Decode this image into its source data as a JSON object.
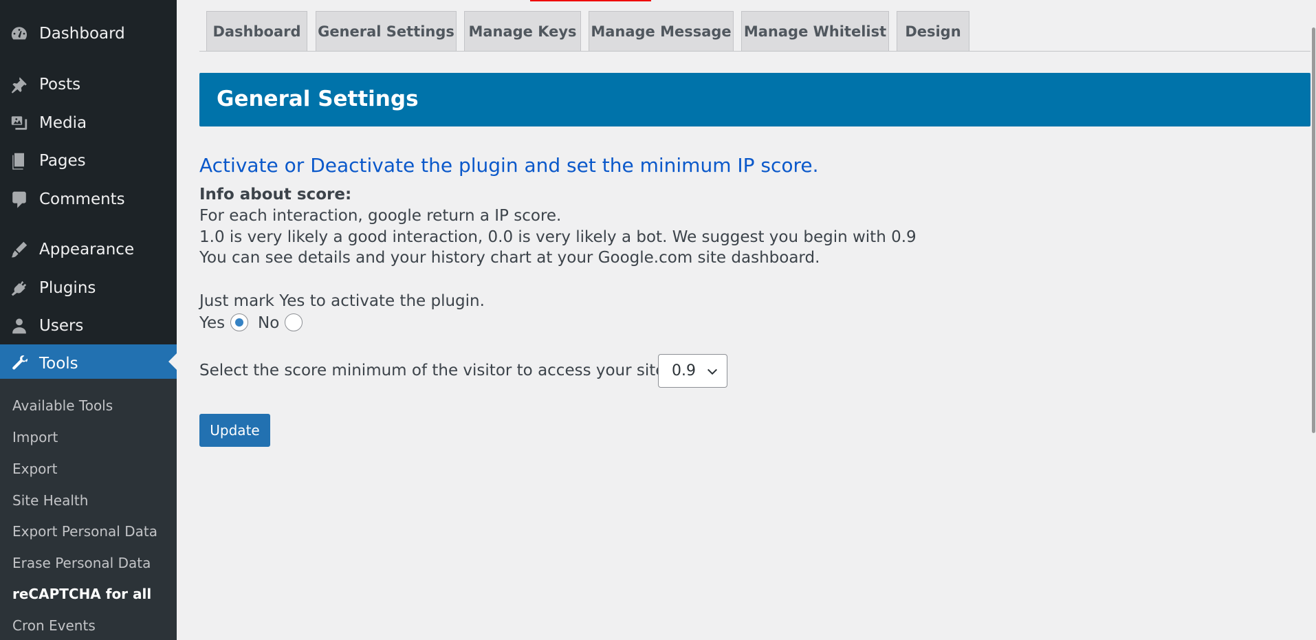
{
  "sidebar": {
    "items": [
      {
        "label": "Dashboard",
        "icon": "dashboard-icon"
      },
      {
        "label": "Posts",
        "icon": "pin-icon"
      },
      {
        "label": "Media",
        "icon": "media-icon"
      },
      {
        "label": "Pages",
        "icon": "pages-icon"
      },
      {
        "label": "Comments",
        "icon": "comment-icon"
      },
      {
        "label": "Appearance",
        "icon": "brush-icon"
      },
      {
        "label": "Plugins",
        "icon": "plug-icon"
      },
      {
        "label": "Users",
        "icon": "user-icon"
      },
      {
        "label": "Tools",
        "icon": "wrench-icon",
        "active": true
      }
    ],
    "submenu": [
      "Available Tools",
      "Import",
      "Export",
      "Site Health",
      "Export Personal Data",
      "Erase Personal Data",
      "reCAPTCHA for all",
      "Cron Events"
    ],
    "current_submenu": "reCAPTCHA for all"
  },
  "tabs": [
    "Dashboard",
    "General Settings",
    "Manage Keys",
    "Manage Message",
    "Manage Whitelist",
    "Design"
  ],
  "header": {
    "title": "General Settings"
  },
  "content": {
    "subtitle": "Activate or Deactivate the plugin and set the minimum IP score.",
    "info_heading": "Info about score:",
    "info_line1": "For each interaction, google return a IP score.",
    "info_line2": "1.0 is very likely a good interaction, 0.0 is very likely a bot. We suggest you begin with 0.9",
    "info_line3": "You can see details and your history chart at your Google.com site dashboard.",
    "activate_text": "Just mark Yes to activate the plugin.",
    "yes_label": "Yes",
    "no_label": "No",
    "selected_option": "Yes",
    "score_label": "Select the score minimum of the visitor to access your site:",
    "score_value": "0.9",
    "update_label": "Update"
  },
  "colors": {
    "sidebar_bg": "#1d2327",
    "submenu_bg": "#2c3338",
    "accent": "#2271b1",
    "header_bg": "#0073aa",
    "subtitle": "#0a58ca"
  }
}
